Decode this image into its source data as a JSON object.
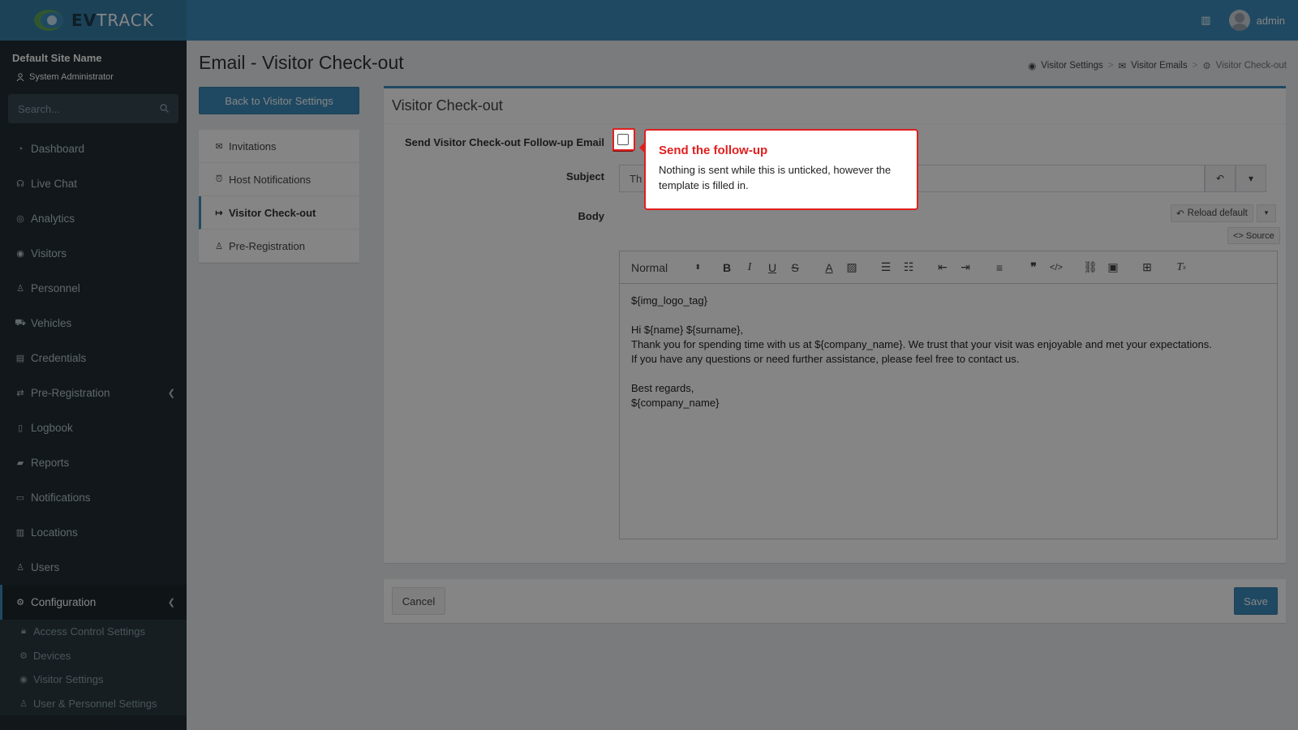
{
  "app": {
    "logo_prefix": "EV",
    "logo_suffix": "TRACK",
    "user_name": "admin"
  },
  "sidebar": {
    "site_name": "Default Site Name",
    "role": "System Administrator",
    "search_placeholder": "Search...",
    "items": [
      {
        "label": "Dashboard",
        "icon": "dashboard-icon"
      },
      {
        "label": "Live Chat",
        "icon": "headset-icon"
      },
      {
        "label": "Analytics",
        "icon": "target-icon"
      },
      {
        "label": "Visitors",
        "icon": "eye-icon"
      },
      {
        "label": "Personnel",
        "icon": "user-icon"
      },
      {
        "label": "Vehicles",
        "icon": "car-icon"
      },
      {
        "label": "Credentials",
        "icon": "id-card-icon"
      },
      {
        "label": "Pre-Registration",
        "icon": "arrows-icon"
      },
      {
        "label": "Logbook",
        "icon": "book-icon"
      },
      {
        "label": "Reports",
        "icon": "chart-icon"
      },
      {
        "label": "Notifications",
        "icon": "bell-icon"
      },
      {
        "label": "Locations",
        "icon": "map-icon"
      },
      {
        "label": "Users",
        "icon": "users-icon"
      },
      {
        "label": "Configuration",
        "icon": "gear-icon"
      }
    ],
    "sub_items": [
      {
        "label": "Access Control Settings",
        "icon": "lock-icon"
      },
      {
        "label": "Devices",
        "icon": "cog-icon"
      },
      {
        "label": "Visitor Settings",
        "icon": "eye-icon"
      },
      {
        "label": "User & Personnel Settings",
        "icon": "user-icon"
      }
    ]
  },
  "header": {
    "title": "Email - Visitor Check-out",
    "breadcrumb": [
      "Visitor Settings",
      "Visitor Emails",
      "Visitor Check-out"
    ]
  },
  "left_panel": {
    "back_label": "Back to Visitor Settings",
    "menu": [
      "Invitations",
      "Host Notifications",
      "Visitor Check-out",
      "Pre-Registration"
    ]
  },
  "form": {
    "box_title": "Visitor Check-out",
    "send_label": "Send Visitor Check-out Follow-up Email",
    "send_checked": false,
    "subject_label": "Subject",
    "subject_value": "Th",
    "body_label": "Body",
    "reload_label": "Reload default",
    "source_label": "<> Source",
    "format_value": "Normal",
    "body_lines": [
      "${img_logo_tag}",
      "",
      "Hi ${name} ${surname},",
      "Thank you for spending time with us at ${company_name}. We trust that your visit was enjoyable and met your expectations.",
      "If you have any questions or need further assistance, please feel free to contact us.",
      "",
      "Best regards,",
      "${company_name}"
    ]
  },
  "footer": {
    "cancel_label": "Cancel",
    "save_label": "Save"
  },
  "tooltip": {
    "title": "Send the follow-up",
    "body": "Nothing is sent while this is unticked, however the template is filled in."
  },
  "colors": {
    "accent": "#3c8dbc",
    "sidebar_bg": "#222d32",
    "highlight": "#e0201f"
  }
}
